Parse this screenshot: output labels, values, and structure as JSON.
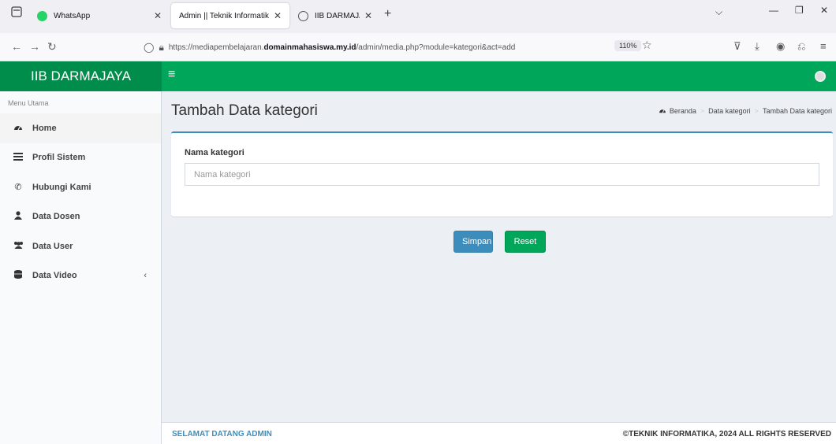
{
  "browser": {
    "tabs": [
      {
        "title": "WhatsApp",
        "active": false,
        "favicon_color": "#25d366"
      },
      {
        "title": "Admin || Teknik Informatika",
        "active": true,
        "favicon_color": ""
      },
      {
        "title": "IIB DARMAJAYA",
        "active": false,
        "favicon_color": "#555555"
      }
    ],
    "new_tab": "+",
    "url_prefix": "https://mediapembelajaran.",
    "url_domain": "domainmahasiswa.my.id",
    "url_path": "/admin/media.php?module=kategori&act=add",
    "zoom": "110%"
  },
  "app": {
    "logo": "IIB DARMAJAYA",
    "accent_color": "#00a65a",
    "primary_color": "#3c8dbc"
  },
  "sidebar": {
    "header": "Menu Utama",
    "items": [
      {
        "label": "Home",
        "icon": "dashboard-icon"
      },
      {
        "label": "Profil Sistem",
        "icon": "list-icon"
      },
      {
        "label": "Hubungi Kami",
        "icon": "phone-icon"
      },
      {
        "label": "Data Dosen",
        "icon": "user-icon"
      },
      {
        "label": "Data User",
        "icon": "users-icon"
      },
      {
        "label": "Data Video",
        "icon": "database-icon"
      }
    ]
  },
  "main": {
    "page_title": "Tambah Data kategori",
    "breadcrumb": [
      "Beranda",
      "Data kategori",
      "Tambah Data kategori"
    ],
    "form": {
      "field_label": "Nama kategori",
      "field_placeholder": "Nama kategori",
      "field_value": ""
    },
    "buttons": {
      "save": "Simpan",
      "reset": "Reset"
    }
  },
  "footer": {
    "left": "SELAMAT DATANG ADMIN",
    "right": "©TEKNIK INFORMATIKA, 2024 ALL RIGHTS RESERVED"
  }
}
